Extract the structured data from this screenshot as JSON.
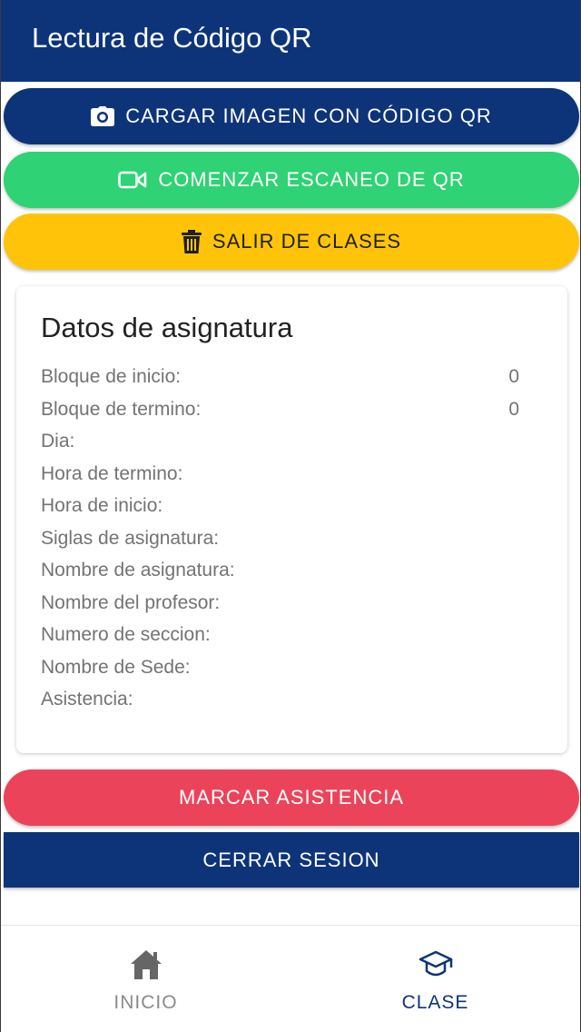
{
  "header": {
    "title": "Lectura de Código QR"
  },
  "actions": {
    "upload_label": "CARGAR IMAGEN CON CÓDIGO QR",
    "scan_label": "COMENZAR ESCANEO DE QR",
    "exit_label": "SALIR DE CLASES"
  },
  "card": {
    "title": "Datos de asignatura",
    "rows": [
      {
        "label": "Bloque de inicio:",
        "value": "0"
      },
      {
        "label": "Bloque de termino:",
        "value": "0"
      },
      {
        "label": "Dia:",
        "value": ""
      },
      {
        "label": "Hora de termino:",
        "value": ""
      },
      {
        "label": "Hora de inicio:",
        "value": ""
      },
      {
        "label": "Siglas de asignatura:",
        "value": ""
      },
      {
        "label": "Nombre de asignatura:",
        "value": ""
      },
      {
        "label": "Nombre del profesor:",
        "value": ""
      },
      {
        "label": "Numero de seccion:",
        "value": ""
      },
      {
        "label": "Nombre de Sede:",
        "value": ""
      },
      {
        "label": "Asistencia:",
        "value": ""
      }
    ]
  },
  "footer_actions": {
    "attend_label": "MARCAR ASISTENCIA",
    "logout_label": "CERRAR SESION"
  },
  "tabs": [
    {
      "label": "INICIO",
      "icon": "home-icon",
      "active": false
    },
    {
      "label": "CLASE",
      "icon": "school-icon",
      "active": true
    }
  ],
  "colors": {
    "primary": "#0d3479",
    "success": "#2fd274",
    "warning": "#ffc409",
    "danger": "#eb445a"
  }
}
